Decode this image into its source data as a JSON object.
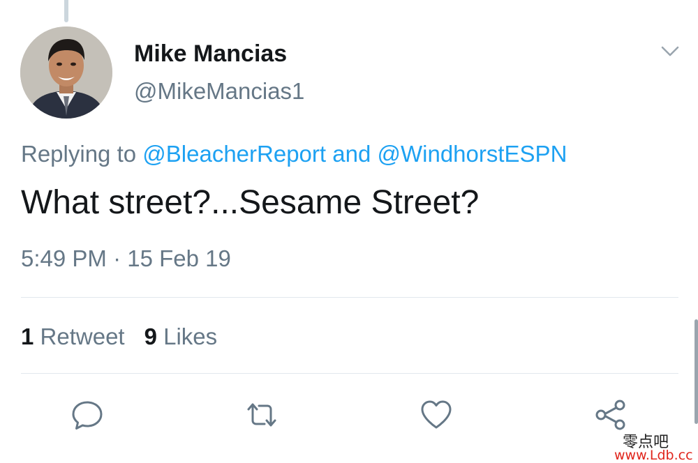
{
  "tweet": {
    "author_name": "Mike Mancias",
    "author_handle": "@MikeMancias1",
    "replying_prefix": "Replying to",
    "reply_to_1": "@BleacherReport",
    "reply_joiner": "and",
    "reply_to_2": "@WindhorstESPN",
    "text": "What street?...Sesame Street?",
    "time": "5:49 PM",
    "separator": "·",
    "date": "15 Feb 19",
    "retweet_count": "1",
    "retweet_label": "Retweet",
    "like_count": "9",
    "like_label": "Likes"
  },
  "icons": {
    "menu": "chevron-down-icon",
    "reply": "reply-bubble-icon",
    "retweet": "retweet-icon",
    "like": "heart-icon",
    "share": "share-icon"
  },
  "colors": {
    "link": "#1da1f2",
    "secondary_text": "#657786",
    "primary_text": "#14171a",
    "icon": "#657786"
  },
  "watermark": {
    "chinese": "零点吧",
    "url": "www.Ldb.cc"
  }
}
